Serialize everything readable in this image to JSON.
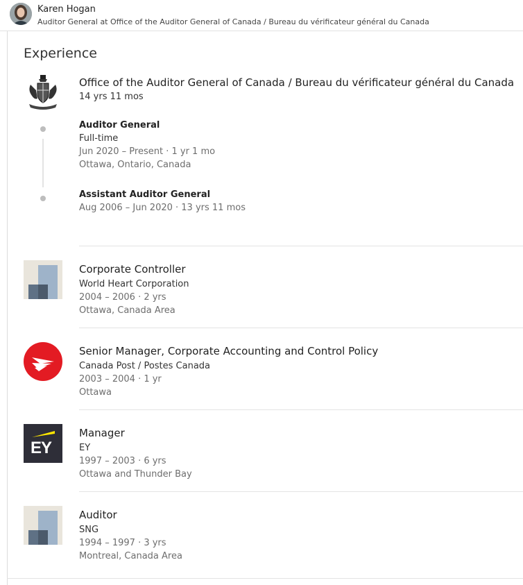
{
  "profile": {
    "name": "Karen Hogan",
    "headline": "Auditor General at Office of the Auditor General of Canada / Bureau du vérificateur général du Canada"
  },
  "section": {
    "title": "Experience"
  },
  "oag": {
    "company": "Office of the Auditor General of Canada / Bureau du vérificateur général du Canada",
    "duration": "14 yrs 11 mos",
    "roles": [
      {
        "title": "Auditor General",
        "type": "Full-time",
        "dates": "Jun 2020 – Present · 1 yr 1 mo",
        "location": "Ottawa, Ontario, Canada"
      },
      {
        "title": "Assistant Auditor General",
        "dates": "Aug 2006 – Jun 2020 · 13 yrs 11 mos"
      }
    ]
  },
  "positions": [
    {
      "title": "Corporate Controller",
      "company": "World Heart Corporation",
      "dates": "2004 – 2006 · 2 yrs",
      "location": "Ottawa, Canada Area"
    },
    {
      "title": "Senior Manager, Corporate Accounting and Control Policy",
      "company": "Canada Post / Postes Canada",
      "dates": "2003 – 2004 · 1 yr",
      "location": "Ottawa"
    },
    {
      "title": "Manager",
      "company": "EY",
      "dates": "1997 – 2003 · 6 yrs",
      "location": "Ottawa and Thunder Bay"
    },
    {
      "title": "Auditor",
      "company": "SNG",
      "dates": "1994 – 1997 · 3 yrs",
      "location": "Montreal, Canada Area"
    }
  ],
  "logos": {
    "ey_text": "EY",
    "canada_post_color": "#e31b23",
    "ey_bg": "#2e2e38",
    "ey_accent": "#ffe600"
  }
}
